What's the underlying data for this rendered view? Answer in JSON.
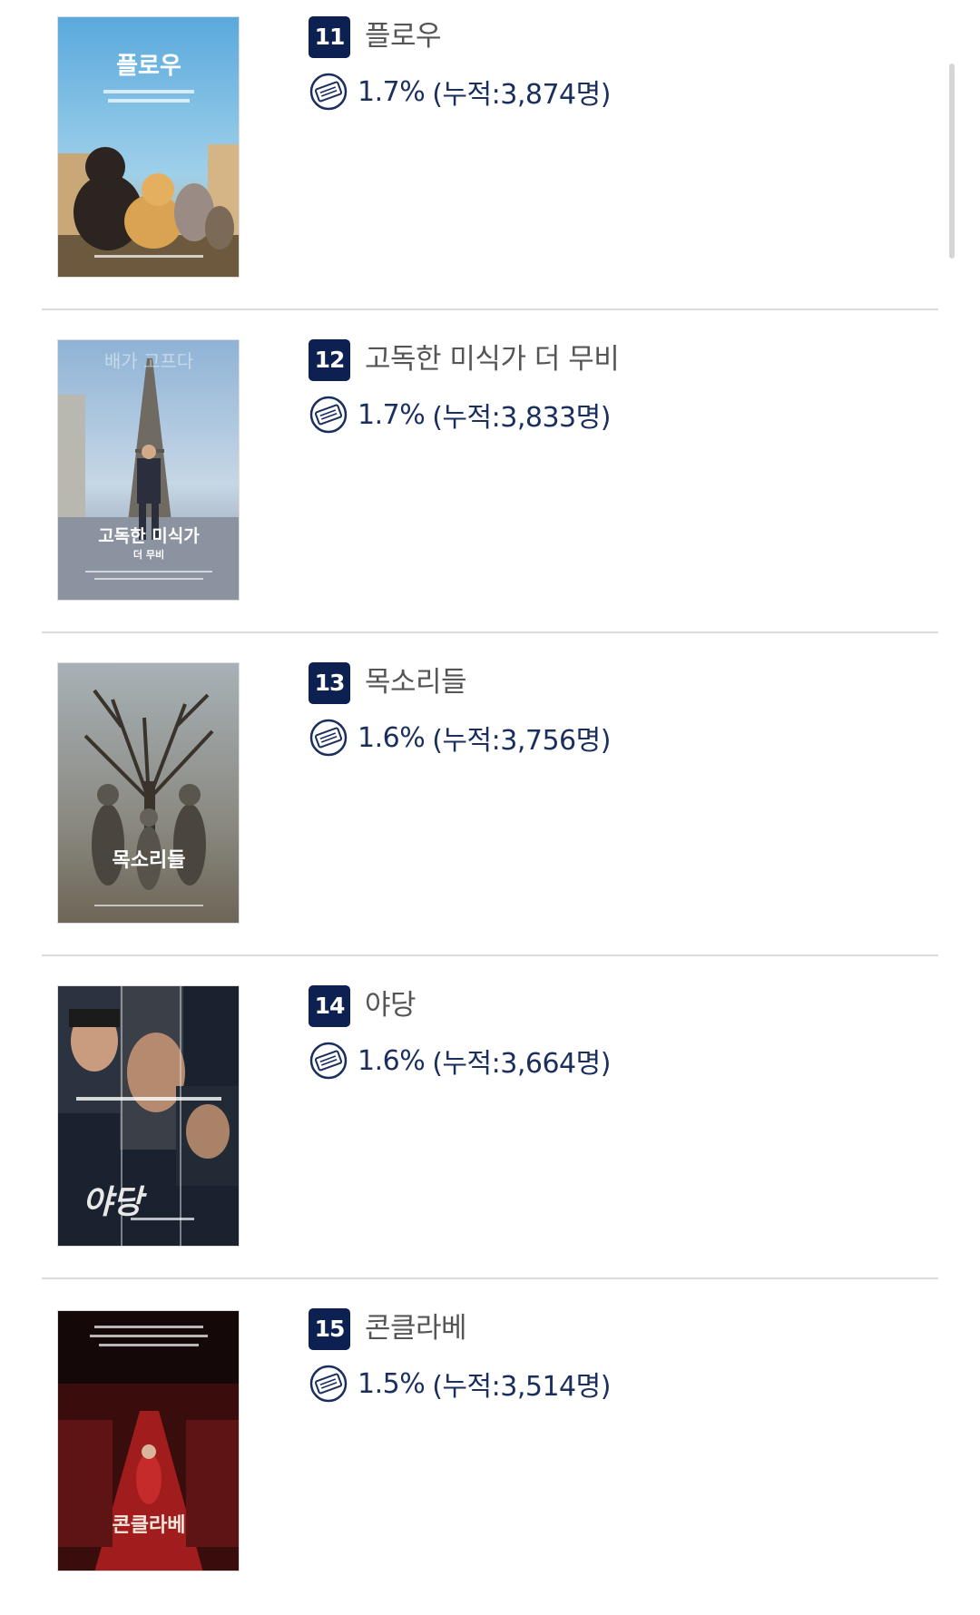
{
  "movies": [
    {
      "rank": "11",
      "title": "플로우",
      "share": "1.7%",
      "cumulative": "(누적:3,874명)"
    },
    {
      "rank": "12",
      "title": "고독한 미식가 더 무비",
      "share": "1.7%",
      "cumulative": "(누적:3,833명)"
    },
    {
      "rank": "13",
      "title": "목소리들",
      "share": "1.6%",
      "cumulative": "(누적:3,756명)"
    },
    {
      "rank": "14",
      "title": "야당",
      "share": "1.6%",
      "cumulative": "(누적:3,664명)"
    },
    {
      "rank": "15",
      "title": "콘클라베",
      "share": "1.5%",
      "cumulative": "(누적:3,514명)"
    }
  ],
  "posters": [
    {
      "text": "플로우",
      "icon": "poster-flow"
    },
    {
      "text": "고독한 미식가",
      "subtext": "더 무비",
      "icon": "poster-solitary-gourmet"
    },
    {
      "text": "목소리들",
      "icon": "poster-voices"
    },
    {
      "text": "야당",
      "icon": "poster-yadang"
    },
    {
      "text": "콘클라베",
      "icon": "poster-conclave"
    }
  ],
  "colors": {
    "rank_badge": "#0c2151",
    "stat_text": "#1b2f5e",
    "title_text": "#555555",
    "divider": "#dcdcdc"
  },
  "icons": {
    "audience": "ticket-icon"
  }
}
